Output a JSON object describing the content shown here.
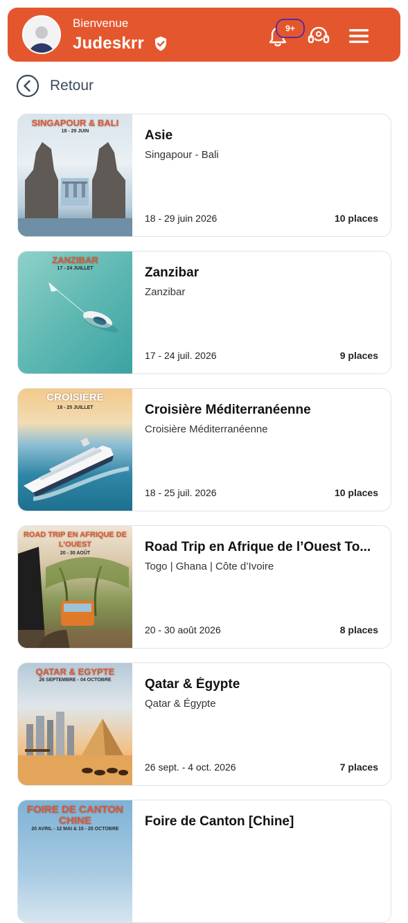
{
  "header": {
    "greeting": "Bienvenue",
    "username": "Judeskrr",
    "notifications_badge": "9+",
    "icons": [
      "bell-icon",
      "headset-icon",
      "menu-icon",
      "verified-icon"
    ]
  },
  "nav": {
    "back_label": "Retour"
  },
  "colors": {
    "accent": "#e4572e",
    "badge_border": "#5a2aa0",
    "card_border": "#dde3ea"
  },
  "trips": [
    {
      "title": "Asie",
      "destination": "Singapour - Bali",
      "dates": "18 - 29 juin 2026",
      "places": "10 places",
      "poster_title": "SINGAPOUR & BALI",
      "poster_date": "18 - 29 JUIN"
    },
    {
      "title": "Zanzibar",
      "destination": "Zanzibar",
      "dates": "17 - 24 juil. 2026",
      "places": "9 places",
      "poster_title": "ZANZIBAR",
      "poster_date": "17 - 24 JUILLET"
    },
    {
      "title": "Croisière Méditerranéenne",
      "destination": "Croisière Méditerranéenne",
      "dates": "18 - 25 juil. 2026",
      "places": "10 places",
      "poster_title": "CROISIÈRE",
      "poster_date": "18 - 25 JUILLET"
    },
    {
      "title": "Road Trip en Afrique de l’Ouest  To...",
      "destination": "Togo | Ghana | Côte d’Ivoire",
      "dates": "20 - 30 août 2026",
      "places": "8 places",
      "poster_title": "ROAD TRIP EN AFRIQUE DE L’OUEST",
      "poster_date": "20 - 30 AOÛT"
    },
    {
      "title": "Qatar & Égypte",
      "destination": "Qatar & Égypte",
      "dates": "26 sept. - 4 oct. 2026",
      "places": "7 places",
      "poster_title": "QATAR & EGYPTE",
      "poster_date": "26 SEPTEMBRE - 04 OCTOBRE"
    },
    {
      "title": "Foire de Canton [Chine]",
      "destination": "",
      "dates": "",
      "places": "",
      "poster_title": "FOIRE DE CANTON CHINE",
      "poster_date": "20 AVRIL - 12 MAI & 15 - 25 OCTOBRE"
    }
  ]
}
